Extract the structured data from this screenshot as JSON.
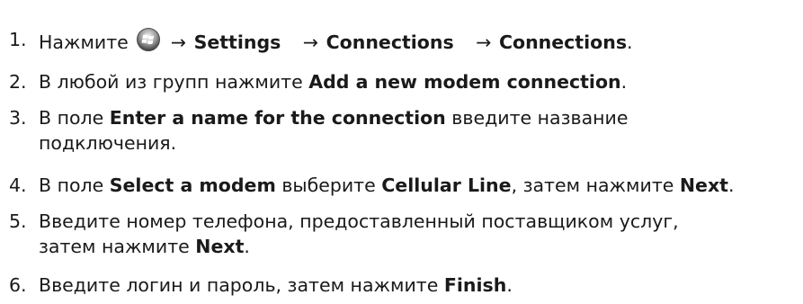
{
  "steps": [
    {
      "number": "1.",
      "lead": "Нажмите",
      "start_icon": "windows-start-icon",
      "arrow": "→",
      "path": [
        "Settings",
        "Connections",
        "Connections"
      ],
      "tail": "."
    },
    {
      "number": "2.",
      "text_before": "В любой из групп нажмите ",
      "bold": "Add a new modem connection",
      "text_after": "."
    },
    {
      "number": "3.",
      "text_before": "В поле ",
      "bold": "Enter a name for the connection",
      "text_after": " введите название",
      "line2": "подключения."
    },
    {
      "number": "4.",
      "text_before": "В поле ",
      "bold1": "Select a modem",
      "text_mid1": " выберите ",
      "bold2": "Cellular Line",
      "text_mid2": ", затем нажмите ",
      "bold3": "Next",
      "text_after": "."
    },
    {
      "number": "5.",
      "line1": "Введите номер телефона, предоставленный поставщиком услуг,",
      "line2_before": "затем нажмите ",
      "bold": "Next",
      "text_after": "."
    },
    {
      "number": "6.",
      "text_before": "Введите логин и пароль, затем нажмите ",
      "bold": "Finish",
      "text_after": "."
    }
  ]
}
